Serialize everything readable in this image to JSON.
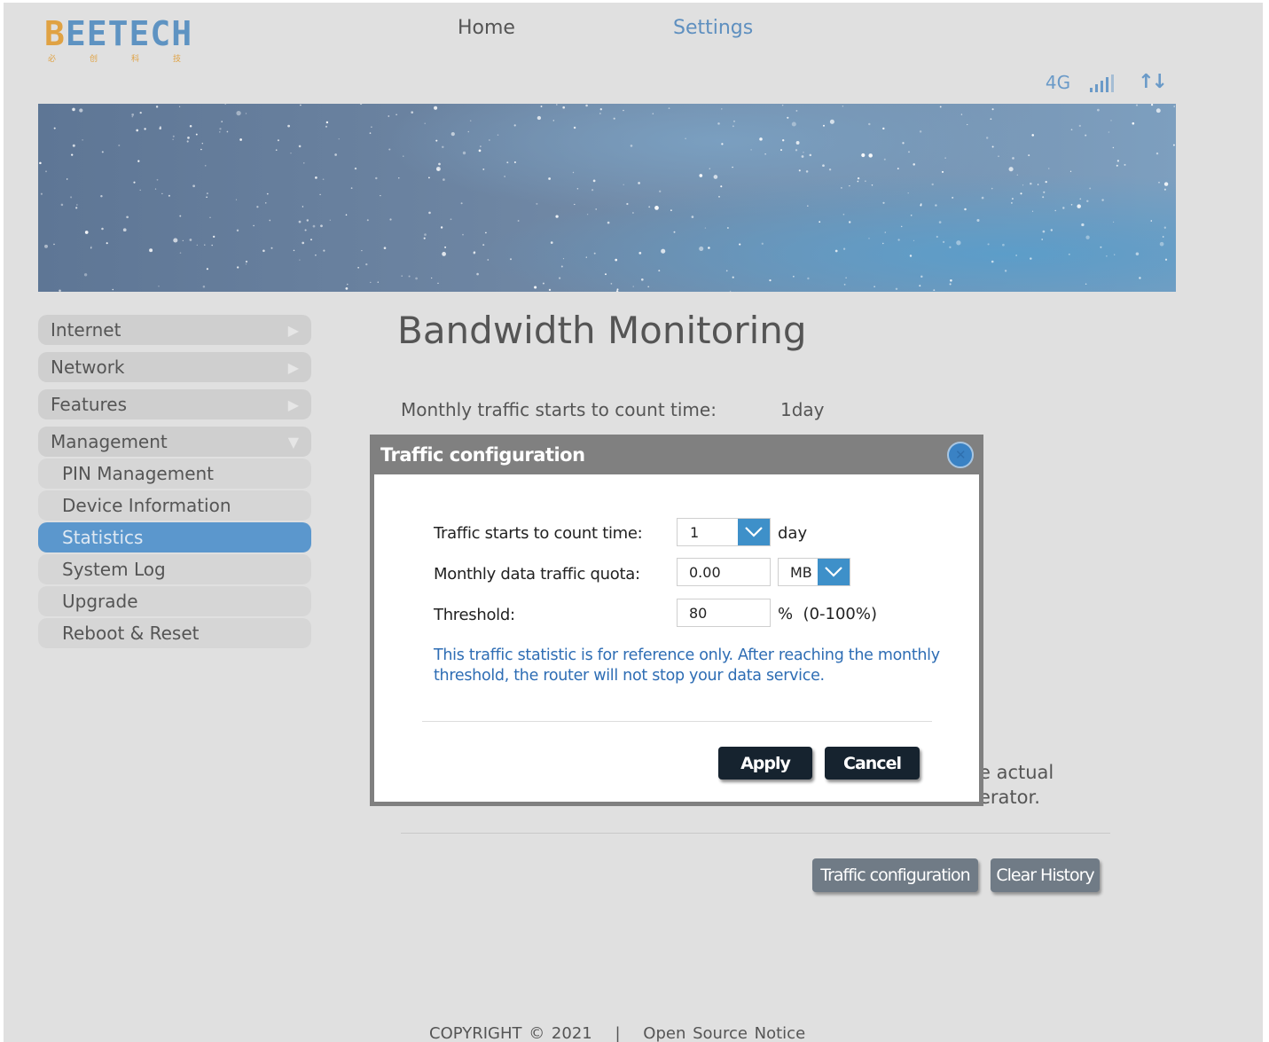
{
  "header": {
    "logo_text_first": "B",
    "logo_text_rest": "EETECH",
    "logo_sub": [
      "必",
      "创",
      "科",
      "技"
    ],
    "nav": {
      "home": "Home",
      "settings": "Settings"
    },
    "status": {
      "network_type": "4G",
      "arrows": "↑↓"
    }
  },
  "sidebar": {
    "items": [
      {
        "label": "Internet",
        "indicator": "▶"
      },
      {
        "label": "Network",
        "indicator": "▶"
      },
      {
        "label": "Features",
        "indicator": "▶"
      },
      {
        "label": "Management",
        "indicator": "▼"
      }
    ],
    "management_sub": [
      {
        "label": "PIN Management"
      },
      {
        "label": "Device Information"
      },
      {
        "label": "Statistics",
        "active": true
      },
      {
        "label": "System Log"
      },
      {
        "label": "Upgrade"
      },
      {
        "label": "Reboot & Reset"
      }
    ]
  },
  "main": {
    "title": "Bandwidth Monitoring",
    "count_time_label": "Monthly traffic starts to count time:",
    "count_time_value": "1day",
    "partial_text_1": "e actual",
    "partial_text_2": "erator.",
    "buttons": {
      "traffic_config": "Traffic configuration",
      "clear_history": "Clear History"
    }
  },
  "modal": {
    "title": "Traffic configuration",
    "close_symbol": "✕",
    "count_time_label": "Traffic starts to count time:",
    "count_time_value": "1",
    "count_time_unit": "day",
    "quota_label": "Monthly data traffic quota:",
    "quota_value": "0.00",
    "quota_unit": "MB",
    "threshold_label": "Threshold:",
    "threshold_value": "80",
    "threshold_suffix": "%  (0-100%)",
    "note": "This traffic statistic is for reference only. After reaching the monthly threshold, the router will not stop your data service.",
    "apply_label": "Apply",
    "cancel_label": "Cancel"
  },
  "footer": {
    "copyright": "COPYRIGHT © 2021",
    "separator": "|",
    "open_source": "Open Source Notice"
  },
  "colors": {
    "accent": "#5b97cd",
    "page_background": "#e0e0e0",
    "dark_button": "#16232f",
    "gray_button": "#707b86",
    "note_text": "#2e6db4"
  }
}
